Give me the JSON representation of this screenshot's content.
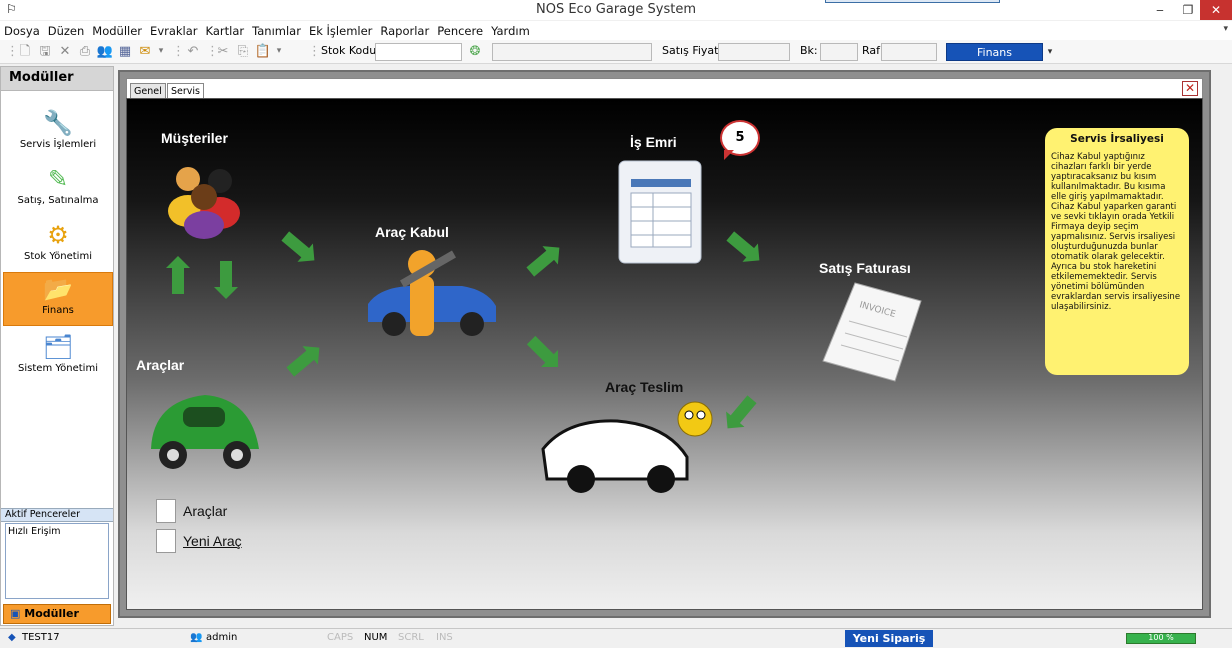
{
  "window": {
    "title": "NOS Eco Garage System"
  },
  "menu": [
    "Dosya",
    "Düzen",
    "Modüller",
    "Evraklar",
    "Kartlar",
    "Tanımlar",
    "Ek İşlemler",
    "Raporlar",
    "Pencere",
    "Yardım"
  ],
  "toolbar": {
    "stok_kodu_label": "Stok Kodu",
    "stok_kodu_value": "",
    "satis_fiyati_label": "Satış Fiyatı",
    "bk_label": "Bk:",
    "raf_label": "Raf",
    "module_select": "Finans"
  },
  "sidebar": {
    "header": "Modüller",
    "items": [
      {
        "label": "Servis İşlemleri",
        "icon": "tools-icon"
      },
      {
        "label": "Satış, Satınalma",
        "icon": "pen-icon"
      },
      {
        "label": "Stok Yönetimi",
        "icon": "gear-icon"
      },
      {
        "label": "Finans",
        "icon": "folder-icon",
        "active": true
      },
      {
        "label": "Sistem Yönetimi",
        "icon": "system-icon"
      }
    ],
    "aktif_pencereler": "Aktif Pencereler",
    "hizli_erisim": "Hızlı Erişim",
    "bottom_tab": "Modüller"
  },
  "tabs": [
    "Genel",
    "Servis"
  ],
  "workflow": {
    "musteriler": "Müşteriler",
    "arac_kabul": "Araç Kabul",
    "is_emri": "İş Emri",
    "is_emri_count": "5",
    "satis_faturasi": "Satış Faturası",
    "araclar": "Araçlar",
    "arac_teslim": "Araç Teslim",
    "invoice_text": "INVOICE"
  },
  "note": {
    "title": "Servis İrsaliyesi",
    "body": "Cihaz Kabul yaptığınız cihazları farklı bir yerde yaptıracaksanız bu kısım kullanılmaktadır. Bu kısıma elle giriş yapılmamaktadır. Cihaz Kabul yaparken garanti ve sevki tıklayın orada Yetkili Firmaya deyip seçim yapmalısınız. Servis irsaliyesi oluşturduğunuzda bunlar otomatik olarak gelecektir. Ayrıca bu stok hareketini etkilememektedir. Servis yönetimi bölümünden evraklardan servis irsaliyesine ulaşabilirsiniz."
  },
  "quick_links": {
    "araclar": "Araçlar",
    "yeni_arac": "Yeni Araç"
  },
  "statusbar": {
    "company": "TEST17",
    "user": "admin",
    "caps": "CAPS",
    "num": "NUM",
    "scrl": "SCRL",
    "ins": "INS",
    "yeni_siparis": "Yeni Sipariş",
    "progress_percent": 100,
    "progress_text": "100 %"
  },
  "colors": {
    "accent_orange": "#f79b2c",
    "accent_blue": "#1653b7",
    "note_yellow": "#fff271",
    "arrow_green": "#3d9b3f"
  }
}
